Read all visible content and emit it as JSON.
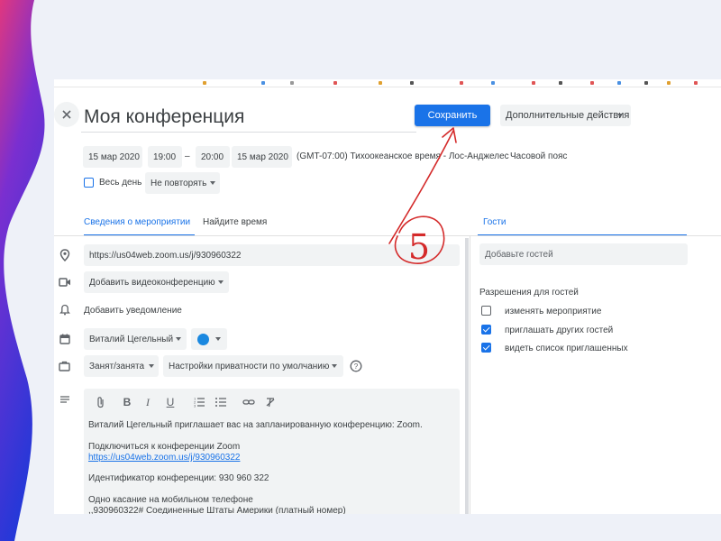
{
  "event": {
    "title": "Моя конференция",
    "save_label": "Сохранить",
    "more_actions_label": "Дополнительные действия",
    "start_date": "15 мар 2020",
    "start_time": "19:00",
    "dash": "–",
    "end_time": "20:00",
    "end_date": "15 мар 2020",
    "timezone": "(GMT-07:00) Тихоокеанское время - Лос-Анджелес",
    "timezone_link": "Часовой пояс",
    "all_day_label": "Весь день",
    "repeat_value": "Не повторять"
  },
  "tabs": {
    "details": "Сведения о мероприятии",
    "find_time": "Найдите время",
    "guests": "Гости"
  },
  "details": {
    "location": "https://us04web.zoom.us/j/930960322",
    "add_video": "Добавить видеоконференцию",
    "add_notification": "Добавить уведомление",
    "calendar_owner": "Виталий Цегельный",
    "event_color": "#1a88e0",
    "busy_status": "Занят/занята",
    "privacy": "Настройки приватности по умолчанию"
  },
  "description": [
    {
      "text": "Виталий Цегельный приглашает вас на запланированную конференцию: Zoom.",
      "link": false
    },
    {
      "text": "Подключиться к конференции Zoom",
      "link": false
    },
    {
      "text": "https://us04web.zoom.us/j/930960322",
      "link": true
    },
    {
      "text": "Идентификатор конференции: 930 960 322",
      "link": false
    },
    {
      "text": "Одно касание на мобильном телефоне",
      "link": false
    },
    {
      "text": ",,930960322# Соединенные Штаты Америки (платный номер)",
      "link": false
    }
  ],
  "guests": {
    "add_placeholder": "Добавьте гостей",
    "permissions_title": "Разрешения для гостей",
    "permissions": [
      {
        "label": "изменять мероприятие",
        "checked": false
      },
      {
        "label": "приглашать других гостей",
        "checked": true
      },
      {
        "label": "видеть список приглашенных",
        "checked": true
      }
    ]
  },
  "annotation": {
    "step_number": "5",
    "color": "#d42a2a"
  },
  "icons": {
    "close": "close-icon",
    "location": "location-pin-icon",
    "video": "video-camera-icon",
    "notification": "bell-icon",
    "calendar": "calendar-icon",
    "briefcase": "briefcase-icon",
    "help": "help-circle-icon",
    "description": "notes-lines-icon"
  },
  "colors": {
    "accent": "#1a73e8",
    "brand_gradient_start": "#3a2bd6",
    "brand_gradient_end": "#e0377f"
  }
}
